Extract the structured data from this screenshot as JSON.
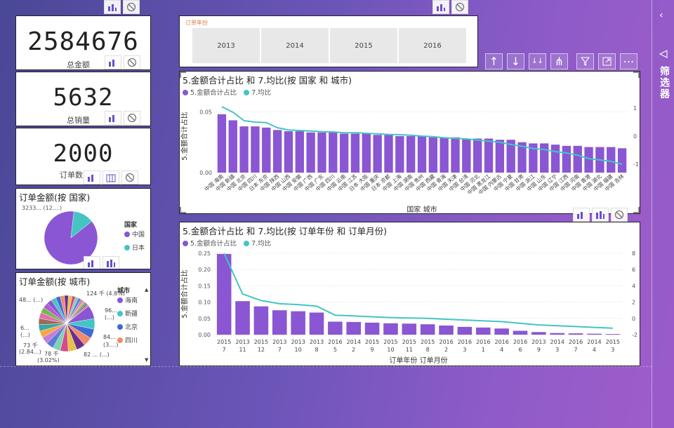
{
  "kpis": [
    {
      "value": "2584676",
      "label": "总金额"
    },
    {
      "value": "5632",
      "label": "总销量"
    },
    {
      "value": "2000",
      "label": "订单数"
    }
  ],
  "slicer": {
    "title": "订单年份",
    "years": [
      "2013",
      "2014",
      "2015",
      "2016"
    ]
  },
  "filters_pane": {
    "label": "筛选器",
    "collapse_icon": "chevron-left-icon",
    "filter_icon": "filter-outline-icon"
  },
  "toolbar_icons": [
    "arrow-up-icon",
    "arrow-down-icon",
    "double-arrow-down-icon",
    "expand-hierarchy-icon",
    "filter-icon",
    "focus-mode-icon",
    "more-options-icon"
  ],
  "pie_country": {
    "title": "订单金额(按 国家)",
    "legend_title": "国家",
    "legend": [
      {
        "name": "中国",
        "color": "#8a56d3"
      },
      {
        "name": "日本",
        "color": "#45c4c4"
      }
    ],
    "label": "3233... (12....)",
    "values": [
      {
        "name": "中国",
        "value": 87.5
      },
      {
        "name": "日本",
        "value": 12.5
      }
    ]
  },
  "pie_city": {
    "title": "订单金额(按 城市)",
    "legend_title": "城市",
    "legend": [
      {
        "name": "海南",
        "color": "#8a56d3"
      },
      {
        "name": "新疆",
        "color": "#45c4c4"
      },
      {
        "name": "北京",
        "color": "#3f6ad6"
      },
      {
        "name": "四川",
        "color": "#f28a6b"
      }
    ],
    "labels": [
      "124 千 (4.8%)",
      "96...",
      "(...)",
      "84...",
      "(3....)",
      "82 ... (...)",
      "78 千",
      "(3.02%)",
      "73 千",
      "(2.84...)",
      "6...",
      "(...)",
      "48... (...)"
    ],
    "colors": [
      "#8a56d3",
      "#45c4c4",
      "#3f6ad6",
      "#f28a6b",
      "#6b2f8c",
      "#e7c14a",
      "#d94a87",
      "#7ed3b2",
      "#5d7bd6",
      "#c77dd8",
      "#f4a742",
      "#3aa6a6",
      "#9a6b5a",
      "#e36fae",
      "#78b84c",
      "#b35ad6"
    ]
  },
  "chart1": {
    "title": "5.金额合计占比 和 7.均比(按 国家 和 城市)",
    "series_names": [
      "5.金额合计占比",
      "7.均比"
    ],
    "xlabel": "国家 城市",
    "ylabel": "5.金额合计占比",
    "yticks": [
      "0.05",
      "0.00"
    ],
    "y2ticks": [
      "1",
      "0",
      "-1"
    ]
  },
  "chart2": {
    "title": "5.金额合计占比 和 7.均比(按 订单年份 和 订单月份)",
    "series_names": [
      "5.金额合计占比",
      "7.均比"
    ],
    "xlabel": "订单年份 订单月份",
    "ylabel": "5.金额合计占比",
    "yticks": [
      "0.25",
      "0.20",
      "0.15",
      "0.10",
      "0.05",
      "0.00"
    ],
    "y2ticks": [
      "8",
      "6",
      "4",
      "2",
      "0",
      "-2"
    ]
  },
  "chart_data": [
    {
      "type": "bar",
      "title": "5.金额合计占比 和 7.均比(按 国家 和 城市)",
      "xlabel": "国家 城市",
      "ylabel": "5.金额合计占比",
      "ylim": [
        0,
        0.06
      ],
      "y2lim": [
        -1.3,
        1.3
      ],
      "categories": [
        "中国 海南",
        "中国 新疆",
        "中国 北京",
        "中国 四川",
        "日本 东京",
        "中国 陕西",
        "中国 山西",
        "中国 安徽",
        "中国 广西",
        "中国 广东",
        "中国 四川",
        "中国 云南",
        "中国 江苏",
        "日本 大阪",
        "中国 重庆",
        "日本 京都",
        "中国 上海",
        "中国 湖南",
        "中国 贵州",
        "中国 西藏",
        "中国 青海",
        "中国 天津",
        "中国 台湾",
        "中国 河北",
        "中国 黑龙江",
        "中国 内蒙古",
        "中国 宁夏",
        "中国 甘肃",
        "中国 浙江",
        "中国 山东",
        "中国 辽宁",
        "中国 江西",
        "中国 河南",
        "中国 香港",
        "中国 湖北",
        "中国 福建",
        "中国 吉林"
      ],
      "series": [
        {
          "name": "5.金额合计占比",
          "values": [
            0.048,
            0.043,
            0.038,
            0.038,
            0.037,
            0.035,
            0.034,
            0.034,
            0.033,
            0.033,
            0.033,
            0.032,
            0.032,
            0.032,
            0.031,
            0.031,
            0.03,
            0.03,
            0.03,
            0.029,
            0.029,
            0.029,
            0.028,
            0.028,
            0.028,
            0.027,
            0.027,
            0.025,
            0.024,
            0.024,
            0.023,
            0.022,
            0.022,
            0.021,
            0.021,
            0.021,
            0.02
          ]
        },
        {
          "name": "7.均比",
          "values": [
            1.05,
            0.85,
            0.55,
            0.5,
            0.48,
            0.3,
            0.22,
            0.2,
            0.18,
            0.16,
            0.15,
            0.12,
            0.12,
            0.1,
            0.08,
            0.06,
            0.05,
            0.03,
            0.0,
            -0.02,
            -0.06,
            -0.08,
            -0.1,
            -0.14,
            -0.18,
            -0.22,
            -0.3,
            -0.36,
            -0.44,
            -0.48,
            -0.55,
            -0.6,
            -0.68,
            -0.8,
            -0.85,
            -0.9,
            -1.0
          ]
        }
      ]
    },
    {
      "type": "bar",
      "title": "5.金额合计占比 和 7.均比(按 订单年份 和 订单月份)",
      "xlabel": "订单年份 订单月份",
      "ylabel": "5.金额合计占比",
      "ylim": [
        0,
        0.25
      ],
      "y2lim": [
        -2,
        8
      ],
      "categories": [
        "2015 7",
        "2013 11",
        "2015 12",
        "2013 7",
        "2013 10",
        "2013 8",
        "2016 5",
        "2014 2",
        "2015 9",
        "2015 10",
        "2015 11",
        "2015 8",
        "2016 2",
        "2016 3",
        "2016 1",
        "2016 4",
        "2016 6",
        "2013 9",
        "2014 3",
        "2016 7",
        "2014 4",
        "2015 3"
      ],
      "series": [
        {
          "name": "5.金额合计占比",
          "values": [
            0.248,
            0.103,
            0.087,
            0.075,
            0.072,
            0.068,
            0.04,
            0.039,
            0.037,
            0.035,
            0.034,
            0.032,
            0.028,
            0.024,
            0.022,
            0.019,
            0.012,
            0.008,
            0.005,
            0.004,
            0.003,
            0.002
          ]
        },
        {
          "name": "7.均比",
          "values": [
            8.0,
            3.0,
            2.2,
            1.8,
            1.7,
            1.5,
            0.4,
            0.3,
            0.2,
            0.1,
            0.05,
            0.0,
            -0.1,
            -0.2,
            -0.3,
            -0.4,
            -0.6,
            -0.8,
            -0.9,
            -1.0,
            -1.1,
            -1.2
          ]
        }
      ]
    }
  ]
}
